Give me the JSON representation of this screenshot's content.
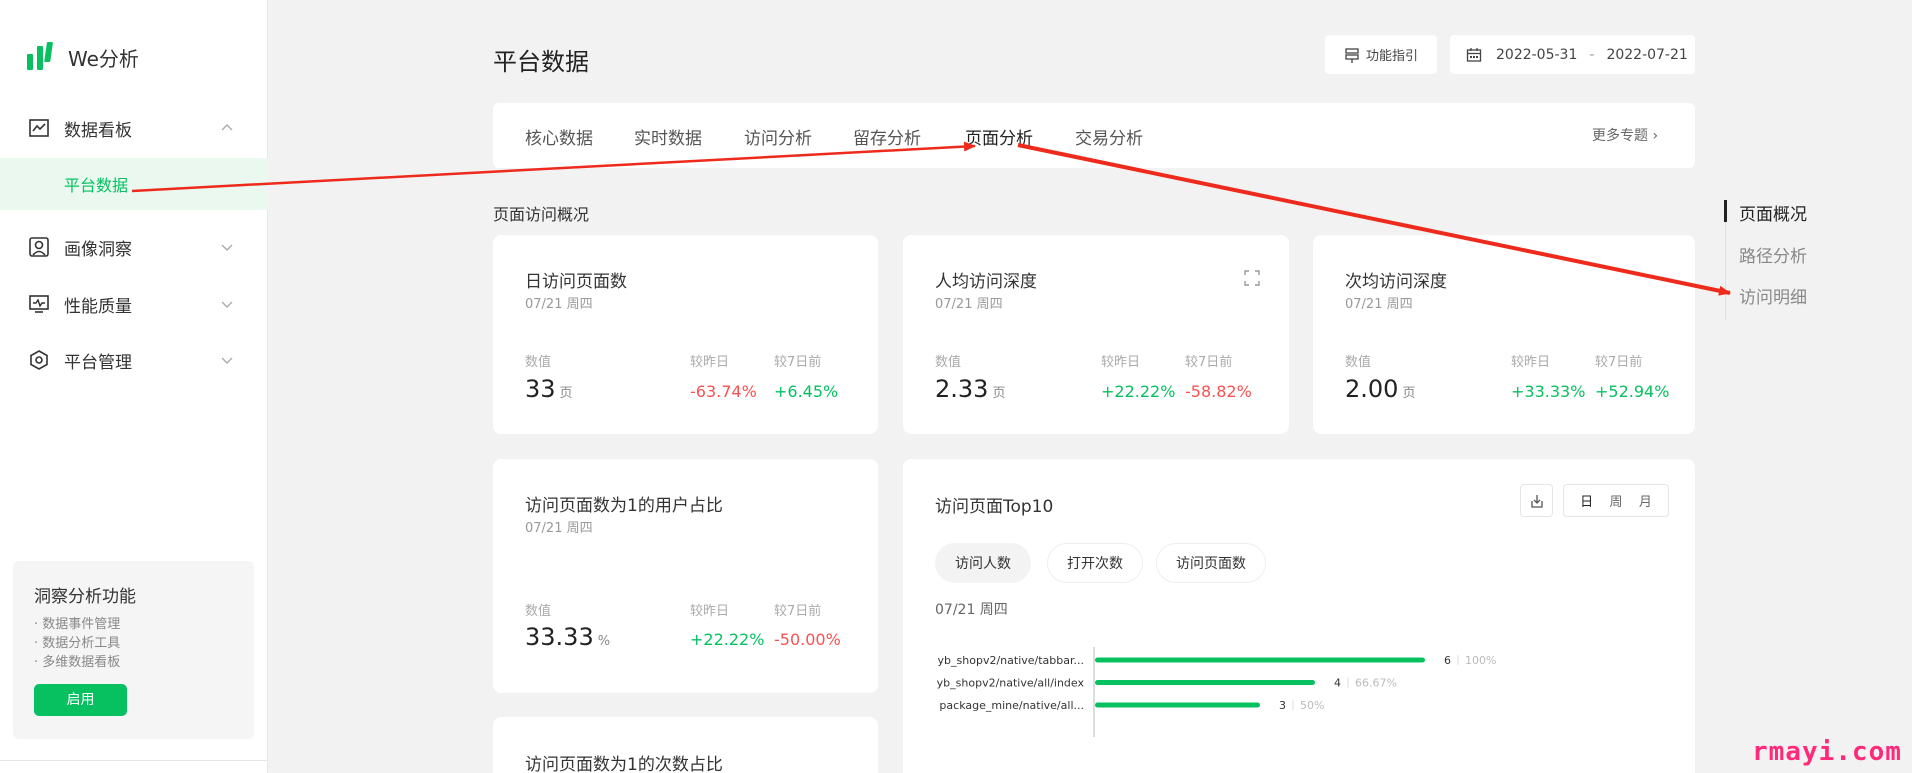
{
  "app": {
    "name": "We分析"
  },
  "sidebar": {
    "items": [
      {
        "label": "数据看板",
        "expanded": true
      },
      {
        "label": "画像洞察"
      },
      {
        "label": "性能质量"
      },
      {
        "label": "平台管理"
      }
    ],
    "sub_item": "平台数据",
    "promo": {
      "title": "洞察分析功能",
      "items": [
        "· 数据事件管理",
        "· 数据分析工具",
        "· 多维数据看板"
      ],
      "button": "启用"
    }
  },
  "header": {
    "title": "平台数据",
    "guide_label": "功能指引",
    "date_start": "2022-05-31",
    "date_sep": "-",
    "date_end": "2022-07-21"
  },
  "tabs": {
    "items": [
      "核心数据",
      "实时数据",
      "访问分析",
      "留存分析",
      "页面分析",
      "交易分析"
    ],
    "active": "页面分析",
    "more": "更多专题 ›"
  },
  "section": {
    "title": "页面访问概况"
  },
  "labels": {
    "value": "数值",
    "vs_yesterday": "较昨日",
    "vs_7days": "较7日前"
  },
  "cards": [
    {
      "title": "日访问页面数",
      "date": "07/21 周四",
      "value": "33",
      "unit": "页",
      "chg_yesterday": "-63.74%",
      "chg_7d": "+6.45%"
    },
    {
      "title": "人均访问深度",
      "date": "07/21 周四",
      "value": "2.33",
      "unit": "页",
      "chg_yesterday": "+22.22%",
      "chg_7d": "-58.82%"
    },
    {
      "title": "次均访问深度",
      "date": "07/21 周四",
      "value": "2.00",
      "unit": "页",
      "chg_yesterday": "+33.33%",
      "chg_7d": "+52.94%"
    },
    {
      "title": "访问页面数为1的用户占比",
      "date": "07/21 周四",
      "value": "33.33",
      "unit": "%",
      "chg_yesterday": "+22.22%",
      "chg_7d": "-50.00%"
    },
    {
      "title": "访问页面数为1的次数占比"
    }
  ],
  "top10": {
    "title": "访问页面Top10",
    "pills": [
      "访问人数",
      "打开次数",
      "访问页面数"
    ],
    "active_pill": "访问人数",
    "period": [
      "日",
      "周",
      "月"
    ],
    "active_period": "日",
    "date": "07/21 周四"
  },
  "chart_data": {
    "type": "bar",
    "orientation": "horizontal",
    "categories": [
      "yb_shopv2/native/tabbar...",
      "yb_shopv2/native/all/index",
      "package_mine/native/all..."
    ],
    "values": [
      6,
      4,
      3
    ],
    "percent_labels": [
      "100%",
      "66.67%",
      "50%"
    ],
    "xlim": [
      0,
      6
    ],
    "bar_color": "#07c160"
  },
  "anchors": {
    "items": [
      "页面概况",
      "路径分析",
      "访问明细"
    ],
    "active": "页面概况"
  },
  "watermark": "rmayi.com",
  "colors": {
    "brand": "#07c160",
    "negative": "#fa5151",
    "annotation": "#ee2a1c"
  }
}
